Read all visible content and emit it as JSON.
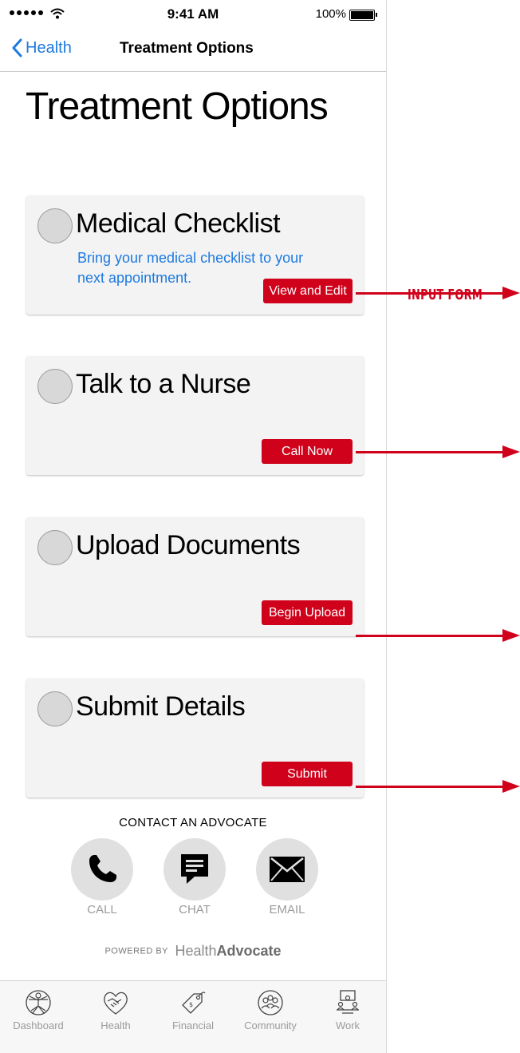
{
  "status_bar": {
    "time": "9:41 AM",
    "battery": "100%"
  },
  "nav": {
    "back_label": "Health",
    "title": "Treatment Options"
  },
  "page": {
    "title": "Treatment Options"
  },
  "cards": [
    {
      "title": "Medical Checklist",
      "description": "Bring your medical checklist to your next appointment.",
      "button": "View and Edit"
    },
    {
      "title": "Talk to a Nurse",
      "description": "",
      "button": "Call Now"
    },
    {
      "title": "Upload Documents",
      "description": "",
      "button": "Begin Upload"
    },
    {
      "title": "Submit Details",
      "description": "",
      "button": "Submit"
    }
  ],
  "contact": {
    "heading": "CONTACT AN ADVOCATE",
    "items": [
      {
        "label": "CALL",
        "icon": "phone-icon"
      },
      {
        "label": "CHAT",
        "icon": "chat-icon"
      },
      {
        "label": "EMAIL",
        "icon": "envelope-icon"
      }
    ]
  },
  "powered_by": {
    "prefix": "POWERED BY",
    "brand_light": "Health",
    "brand_bold": "Advocate"
  },
  "tab_bar": {
    "items": [
      {
        "label": "Dashboard",
        "icon": "vitruvian-man-icon"
      },
      {
        "label": "Health",
        "icon": "handshake-heart-icon"
      },
      {
        "label": "Financial",
        "icon": "price-tag-icon"
      },
      {
        "label": "Community",
        "icon": "community-people-icon"
      },
      {
        "label": "Work",
        "icon": "meeting-table-icon"
      }
    ]
  },
  "annotation": {
    "label": "INPUT FORM",
    "color": "#d0021b"
  },
  "colors": {
    "accent_blue": "#1d7ae0",
    "button_red": "#d0021b",
    "card_bg": "#f3f3f3"
  }
}
